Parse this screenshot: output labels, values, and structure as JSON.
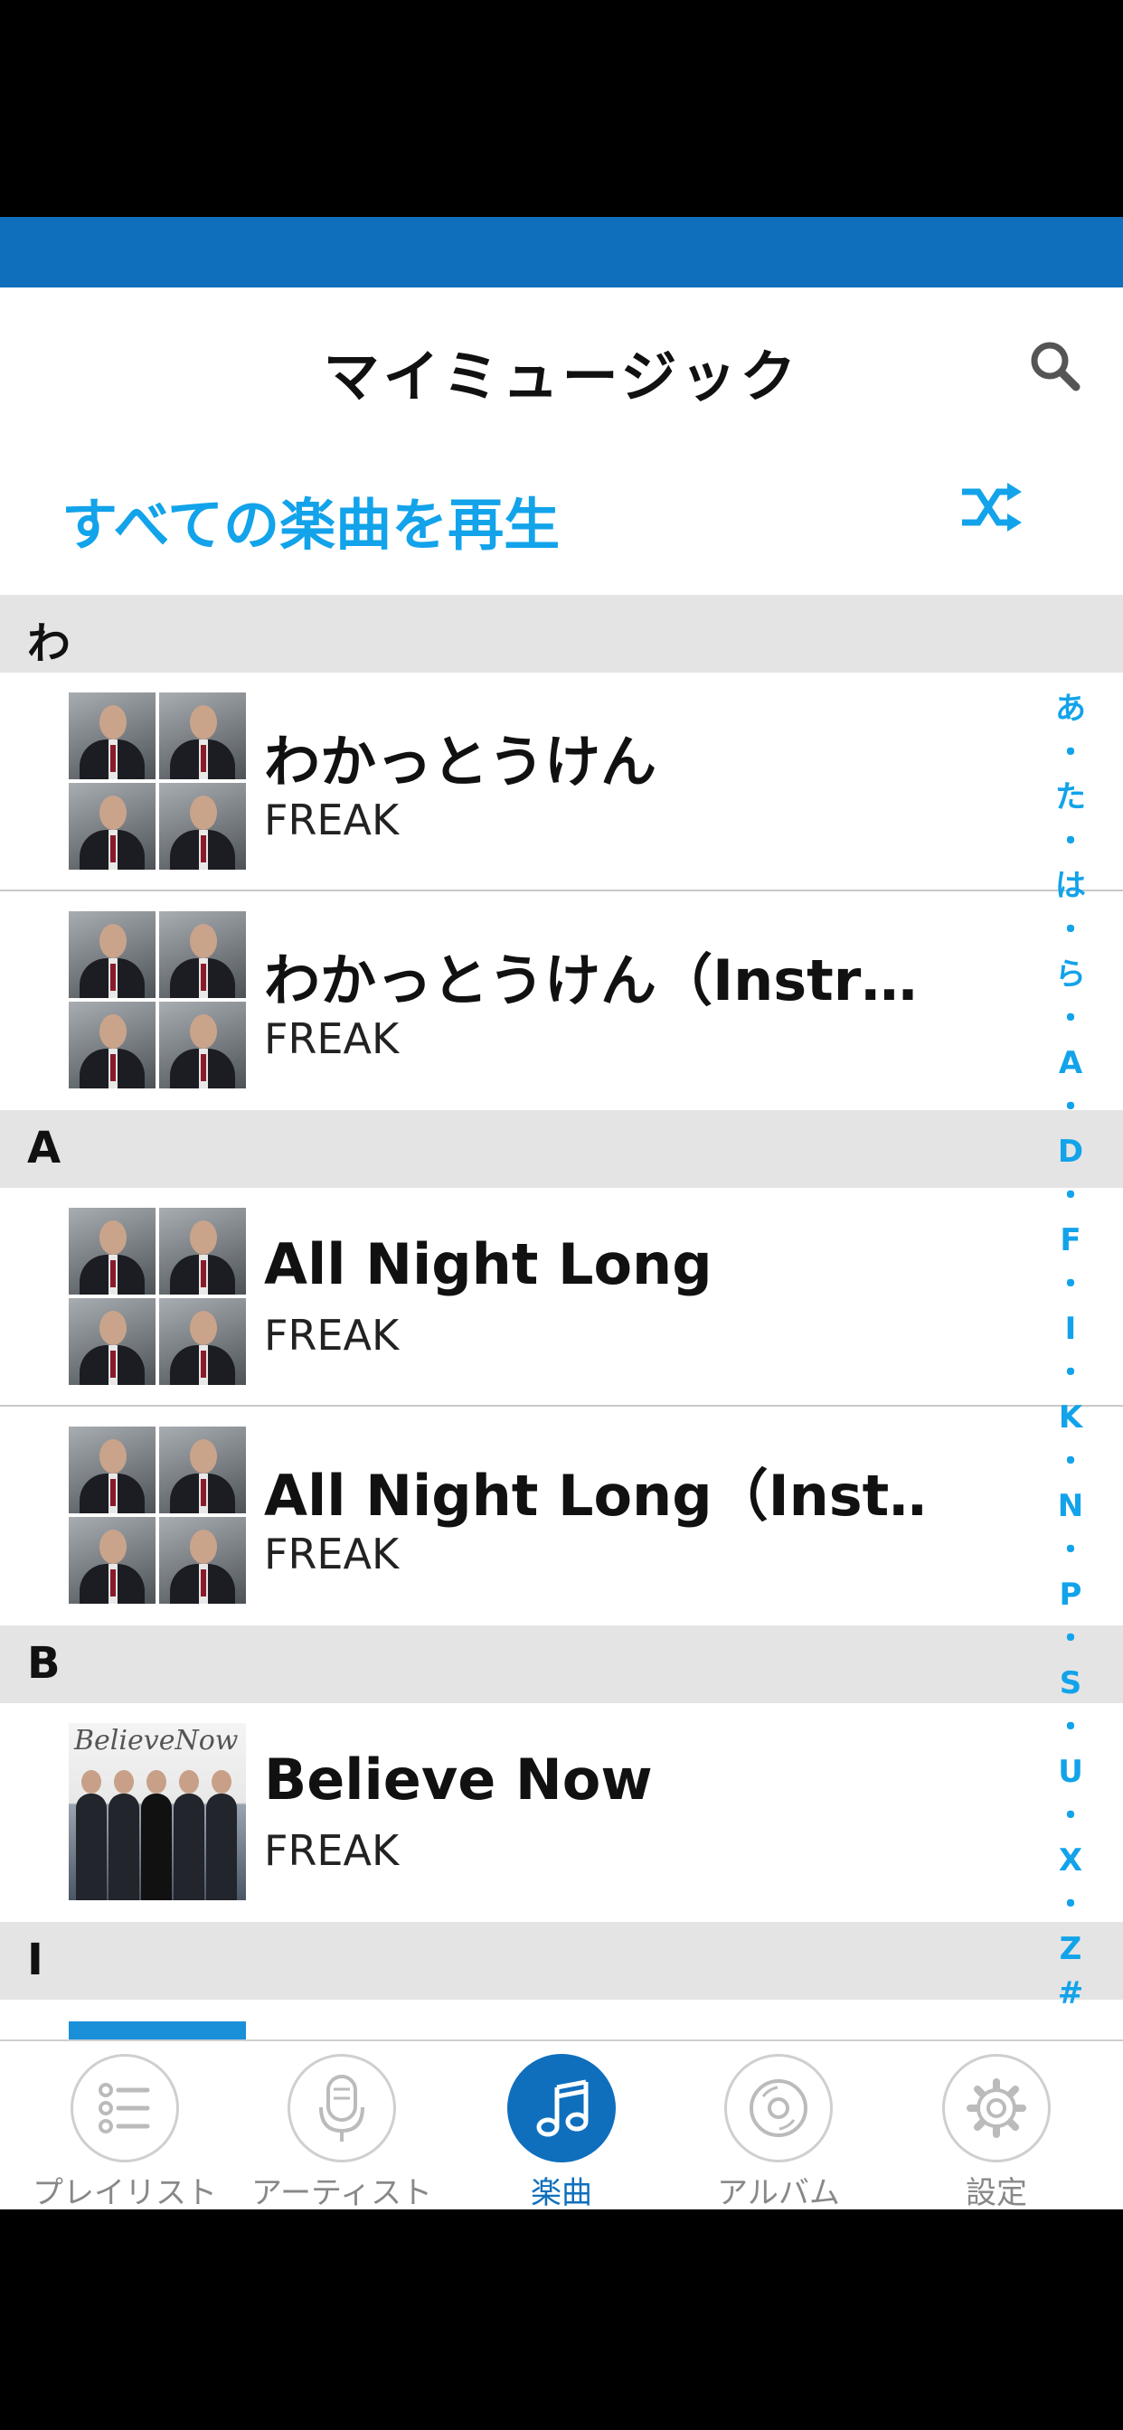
{
  "header": {
    "title": "マイミュージック",
    "search_icon": "search-icon"
  },
  "play_all": {
    "label": "すべての楽曲を再生",
    "shuffle_icon": "shuffle-icon"
  },
  "accent_color": "#12a3ea",
  "brand_color": "#0f6fbd",
  "sections": [
    {
      "letter": "わ",
      "songs": [
        {
          "title": "わかっとうけん",
          "artist": "FREAK"
        },
        {
          "title": "わかっとうけん（Instr…",
          "artist": "FREAK"
        }
      ]
    },
    {
      "letter": "A",
      "songs": [
        {
          "title": "All Night Long",
          "artist": "FREAK"
        },
        {
          "title": "All Night Long（Inst…",
          "artist": "FREAK"
        }
      ]
    },
    {
      "letter": "B",
      "songs": [
        {
          "title": "Believe Now",
          "artist": "FREAK",
          "album_text": "BelieveNow"
        }
      ]
    },
    {
      "letter": "I",
      "songs": []
    }
  ],
  "index": [
    "あ",
    "・",
    "た",
    "・",
    "は",
    "・",
    "ら",
    "・",
    "A",
    "・",
    "D",
    "・",
    "F",
    "・",
    "I",
    "・",
    "K",
    "・",
    "N",
    "・",
    "P",
    "・",
    "S",
    "・",
    "U",
    "・",
    "X",
    "・",
    "Z",
    "#"
  ],
  "tabs": [
    {
      "label": "プレイリスト",
      "icon": "playlist-icon",
      "active": false
    },
    {
      "label": "アーティスト",
      "icon": "microphone-icon",
      "active": false
    },
    {
      "label": "楽曲",
      "icon": "music-note-icon",
      "active": true
    },
    {
      "label": "アルバム",
      "icon": "disc-icon",
      "active": false
    },
    {
      "label": "設定",
      "icon": "gear-icon",
      "active": false
    }
  ]
}
